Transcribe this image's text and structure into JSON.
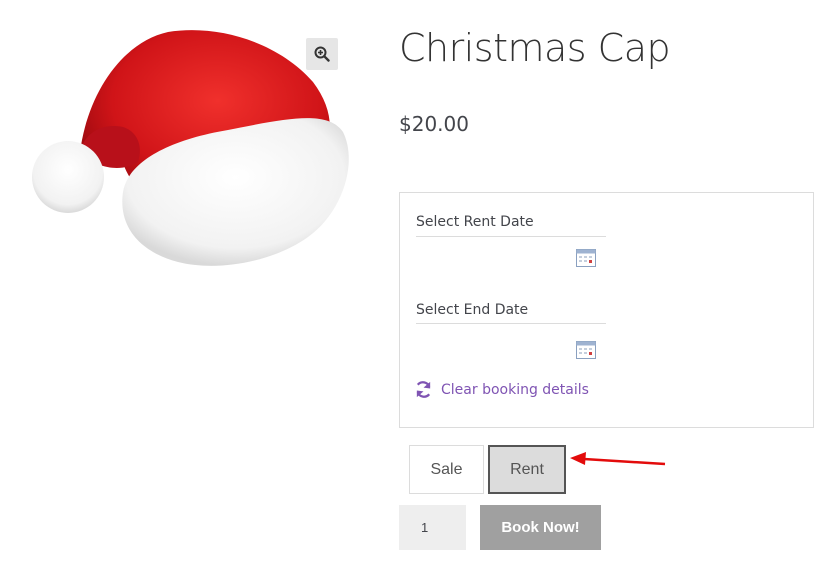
{
  "product": {
    "title": "Christmas Cap",
    "price": "$20.00"
  },
  "booking": {
    "rent_date_label": "Select Rent Date",
    "rent_date_value": "",
    "end_date_label": "Select End Date",
    "end_date_value": "",
    "clear_label": "Clear booking details"
  },
  "mode_toggle": {
    "sale_label": "Sale",
    "rent_label": "Rent",
    "selected": "Rent"
  },
  "cart": {
    "quantity": "1",
    "book_label": "Book Now!"
  },
  "icons": {
    "zoom": "zoom-in-icon",
    "calendar": "calendar-icon",
    "refresh": "refresh-icon"
  },
  "colors": {
    "link": "#7f54b3",
    "cap_red": "#d81e1e",
    "arrow_red": "#e30b0b",
    "book_button_bg": "#a0a0a0"
  }
}
